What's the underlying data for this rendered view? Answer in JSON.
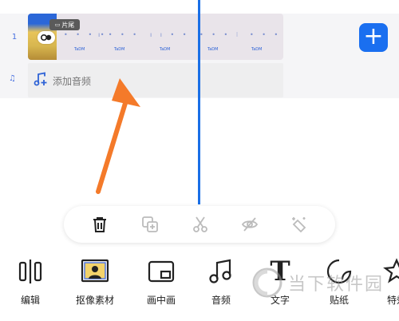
{
  "timeline": {
    "row_number": "1",
    "tail_badge": "片尾",
    "add_audio_label": "添加音频",
    "clip_labels": [
      "TaDM",
      "TaDM",
      "TaDM",
      "TaDM",
      "TaDM"
    ]
  },
  "bottom_tools": [
    {
      "label": "编辑",
      "icon": "split-bars-icon"
    },
    {
      "label": "抠像素材",
      "icon": "portrait-cutout-icon"
    },
    {
      "label": "画中画",
      "icon": "picture-in-picture-icon"
    },
    {
      "label": "音频",
      "icon": "music-note-icon"
    },
    {
      "label": "文字",
      "icon": "text-t-icon"
    },
    {
      "label": "贴纸",
      "icon": "sticker-icon"
    },
    {
      "label": "特效",
      "icon": "effects-icon"
    }
  ],
  "toolbar_icons": [
    "trash-icon",
    "duplicate-icon",
    "scissors-icon",
    "hide-eye-icon",
    "magic-icon"
  ],
  "watermark": {
    "text": "当下软件园"
  },
  "colors": {
    "accent": "#1a6ff0",
    "arrow": "#f47a2a",
    "playhead": "#1a6fe6"
  }
}
